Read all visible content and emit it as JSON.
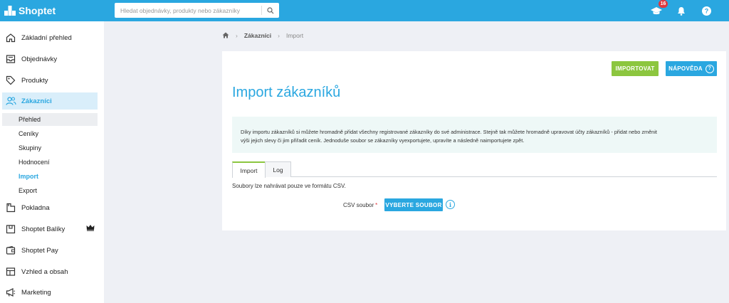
{
  "app": {
    "brand": "Shoptet"
  },
  "search": {
    "placeholder": "Hledat objednávky, produkty nebo zákazníky"
  },
  "topbar": {
    "notification_count": "16"
  },
  "sidebar": {
    "items": [
      {
        "label": "Základní přehled",
        "icon": "home-icon"
      },
      {
        "label": "Objednávky",
        "icon": "inbox-icon"
      },
      {
        "label": "Produkty",
        "icon": "tag-icon"
      },
      {
        "label": "Zákazníci",
        "icon": "users-icon"
      },
      {
        "label": "Pokladna",
        "icon": "register-icon"
      },
      {
        "label": "Shoptet Balíky",
        "icon": "package-icon"
      },
      {
        "label": "Shoptet Pay",
        "icon": "wallet-icon"
      },
      {
        "label": "Vzhled a obsah",
        "icon": "layout-icon"
      },
      {
        "label": "Marketing",
        "icon": "megaphone-icon"
      }
    ],
    "sub_items": [
      "Přehled",
      "Ceníky",
      "Skupiny",
      "Hodnocení",
      "Import",
      "Export"
    ]
  },
  "breadcrumb": {
    "parent": "Zákazníci",
    "current": "Import"
  },
  "actions": {
    "import": "IMPORTOVAT",
    "help": "NÁPOVĚDA",
    "help_glyph": "?"
  },
  "page": {
    "title": "Import zákazníků",
    "info_line1": "Díky importu zákazníků si můžete hromadně přidat všechny registrované zákazníky do své administrace. Stejně tak můžete hromadně upravovat účty zákazníků - přidat nebo změnit",
    "info_line2": "výši jejich slevy či jim přiřadit ceník. Jednoduše soubor se zákazníky vyexportujete, upravíte a následně naimportujete zpět.",
    "tabs": [
      "Import",
      "Log"
    ],
    "note": "Soubory lze nahrávat pouze ve formátu CSV.",
    "csv_label": "CSV soubor",
    "required_mark": "*",
    "choose_file": "VYBERTE SOUBOR",
    "info_glyph": "i"
  },
  "colors": {
    "accent": "#2aa7e0",
    "green": "#8cc63f",
    "badge": "#e0383e"
  }
}
